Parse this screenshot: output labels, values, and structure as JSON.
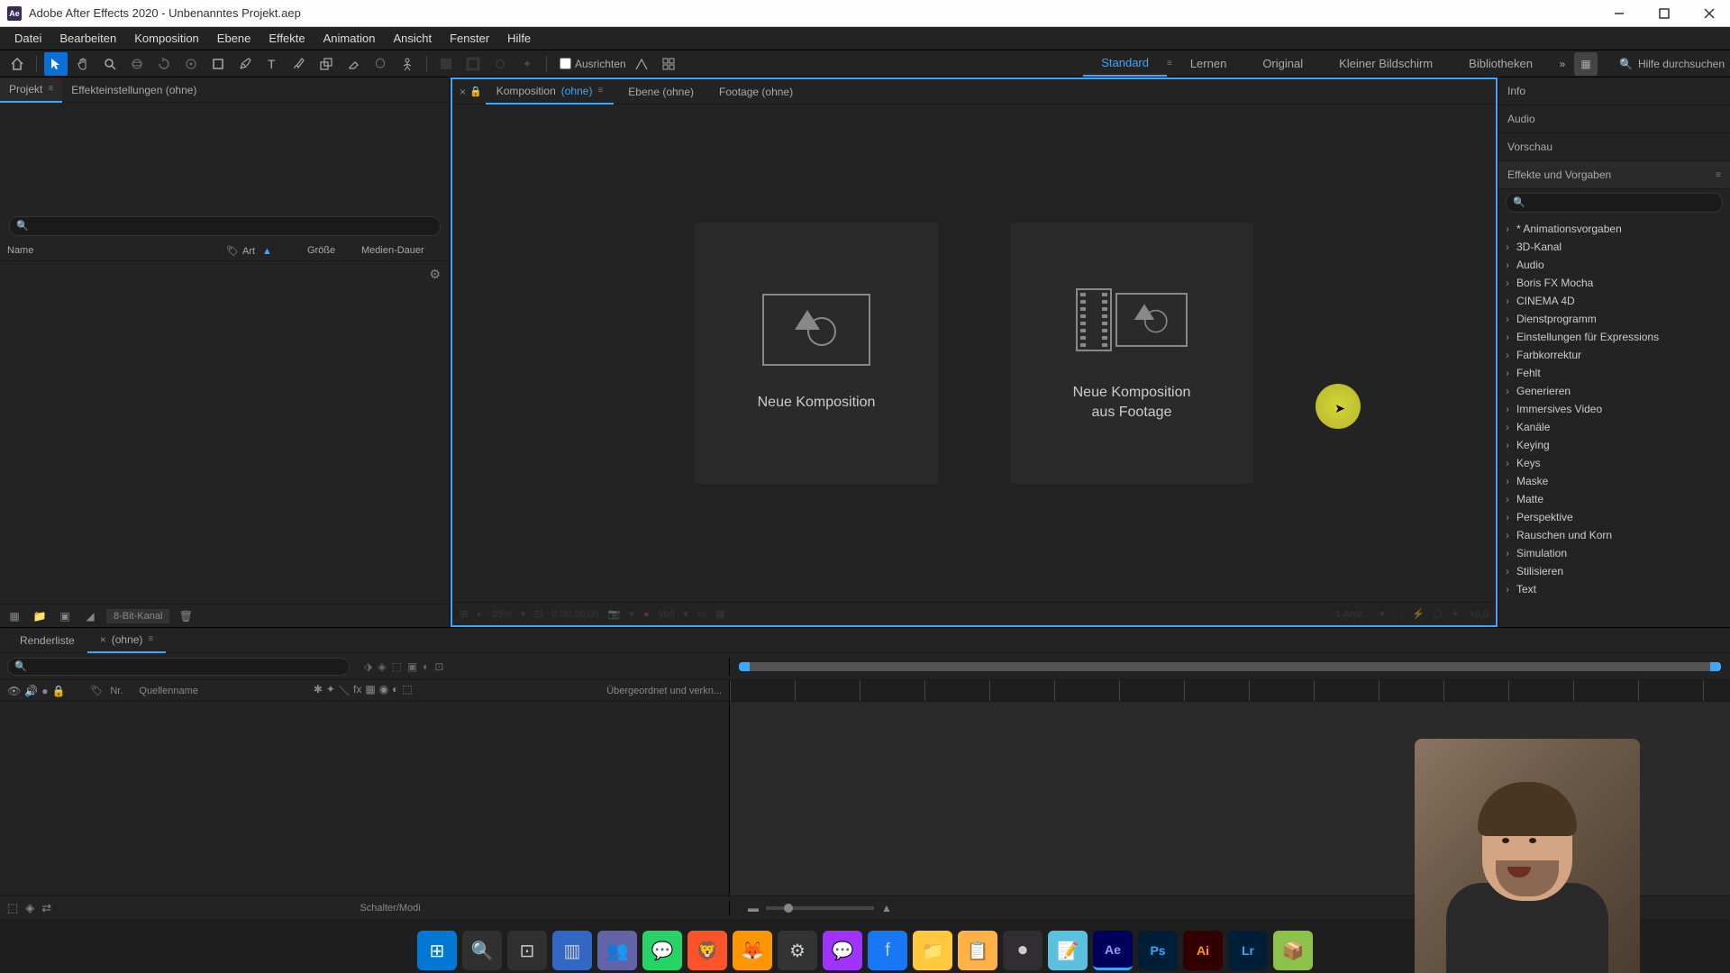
{
  "titlebar": {
    "app_icon_text": "Ae",
    "title": "Adobe After Effects 2020 - Unbenanntes Projekt.aep"
  },
  "menubar": [
    "Datei",
    "Bearbeiten",
    "Komposition",
    "Ebene",
    "Effekte",
    "Animation",
    "Ansicht",
    "Fenster",
    "Hilfe"
  ],
  "toolbar": {
    "snap_label": "Ausrichten",
    "search_placeholder": "Hilfe durchsuchen"
  },
  "workspaces": {
    "items": [
      "Standard",
      "Lernen",
      "Original",
      "Kleiner Bildschirm",
      "Bibliotheken"
    ],
    "active": "Standard"
  },
  "project_panel": {
    "tab_project": "Projekt",
    "tab_effect_controls": "Effekteinstellungen (ohne)",
    "columns": {
      "name": "Name",
      "type": "Art",
      "size": "Größe",
      "media_duration": "Medien-Dauer"
    },
    "bit_depth": "8-Bit-Kanal"
  },
  "viewer": {
    "tab_comp_prefix": "Komposition",
    "tab_comp_none": "(ohne)",
    "tab_layer": "Ebene (ohne)",
    "tab_footage": "Footage (ohne)",
    "new_comp": "Neue Komposition",
    "new_comp_footage_l1": "Neue Komposition",
    "new_comp_footage_l2": "aus Footage",
    "footer": {
      "zoom": "25%",
      "time": "0:00:00:00",
      "res": "Voll",
      "view": "1 Ansi...",
      "exposure": "+0,0"
    }
  },
  "right_panels": {
    "info": "Info",
    "audio": "Audio",
    "preview": "Vorschau",
    "effects_presets": "Effekte und Vorgaben",
    "categories": [
      "* Animationsvorgaben",
      "3D-Kanal",
      "Audio",
      "Boris FX Mocha",
      "CINEMA 4D",
      "Dienstprogramm",
      "Einstellungen für Expressions",
      "Farbkorrektur",
      "Fehlt",
      "Generieren",
      "Immersives Video",
      "Kanäle",
      "Keying",
      "Keys",
      "Maske",
      "Matte",
      "Perspektive",
      "Rauschen und Korn",
      "Simulation",
      "Stilisieren",
      "Text"
    ]
  },
  "timeline": {
    "tab_render": "Renderliste",
    "tab_none": "(ohne)",
    "col_nr": "Nr.",
    "col_source": "Quellenname",
    "col_parent": "Übergeordnet und verkn...",
    "footer_switches": "Schalter/Modi"
  },
  "taskbar": {
    "icons": [
      "windows",
      "search",
      "tasks",
      "widgets",
      "teams",
      "whatsapp",
      "brave",
      "firefox",
      "app1",
      "messenger",
      "facebook",
      "explorer",
      "app2",
      "obs",
      "notepad",
      "ae",
      "ps",
      "ai",
      "lr",
      "app3"
    ]
  }
}
